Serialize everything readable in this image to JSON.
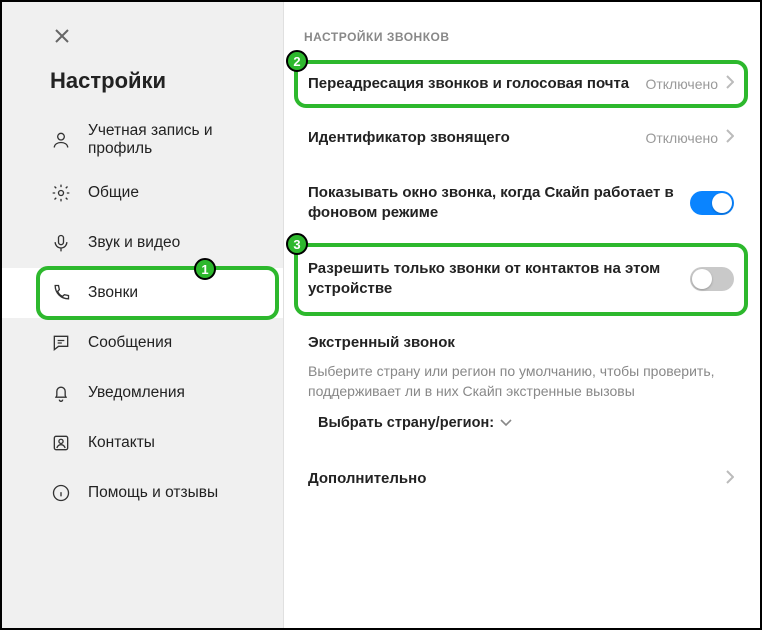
{
  "title": "Настройки",
  "sidebar": {
    "items": [
      {
        "label": "Учетная запись и профиль"
      },
      {
        "label": "Общие"
      },
      {
        "label": "Звук и видео"
      },
      {
        "label": "Звонки"
      },
      {
        "label": "Сообщения"
      },
      {
        "label": "Уведомления"
      },
      {
        "label": "Контакты"
      },
      {
        "label": "Помощь и отзывы"
      }
    ]
  },
  "content": {
    "section_label": "НАСТРОЙКИ ЗВОНКОВ",
    "forwarding": {
      "title": "Переадресация звонков и голосовая почта",
      "status": "Отключено"
    },
    "caller_id": {
      "title": "Идентификатор звонящего",
      "status": "Отключено"
    },
    "show_window": {
      "title": "Показывать окно звонка, когда Скайп работает в фоновом режиме"
    },
    "contacts_only": {
      "title": "Разрешить только звонки от контактов на этом устройстве"
    },
    "emergency": {
      "title": "Экстренный звонок",
      "desc": "Выберите страну или регион по умолчанию, чтобы проверить, поддерживает ли в них Скайп экстренные вызовы",
      "select_label": "Выбрать страну/регион:"
    },
    "advanced": {
      "title": "Дополнительно"
    }
  },
  "badges": {
    "one": "1",
    "two": "2",
    "three": "3"
  }
}
